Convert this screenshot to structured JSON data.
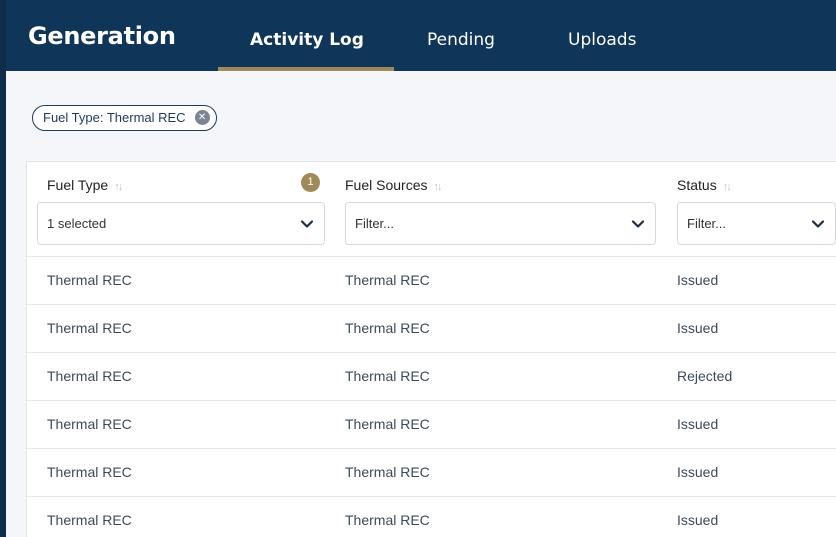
{
  "header": {
    "title": "Generation",
    "tabs": [
      {
        "label": "Activity Log",
        "active": true
      },
      {
        "label": "Pending",
        "active": false
      },
      {
        "label": "Uploads",
        "active": false
      }
    ]
  },
  "filter_chip": {
    "label": "Fuel Type: Thermal REC"
  },
  "table": {
    "columns": [
      {
        "label": "Fuel Type",
        "filter_value": "1 selected",
        "badge": "1"
      },
      {
        "label": "Fuel Sources",
        "filter_placeholder": "Filter..."
      },
      {
        "label": "Status",
        "filter_placeholder": "Filter..."
      }
    ],
    "rows": [
      {
        "fuel_type": "Thermal REC",
        "fuel_sources": "Thermal REC",
        "status": "Issued"
      },
      {
        "fuel_type": "Thermal REC",
        "fuel_sources": "Thermal REC",
        "status": "Issued"
      },
      {
        "fuel_type": "Thermal REC",
        "fuel_sources": "Thermal REC",
        "status": "Rejected"
      },
      {
        "fuel_type": "Thermal REC",
        "fuel_sources": "Thermal REC",
        "status": "Issued"
      },
      {
        "fuel_type": "Thermal REC",
        "fuel_sources": "Thermal REC",
        "status": "Issued"
      },
      {
        "fuel_type": "Thermal REC",
        "fuel_sources": "Thermal REC",
        "status": "Issued"
      }
    ]
  },
  "colors": {
    "header_bg": "#0f3658",
    "accent_gold": "#a08a5a",
    "chip_border": "#1e3a5a"
  }
}
